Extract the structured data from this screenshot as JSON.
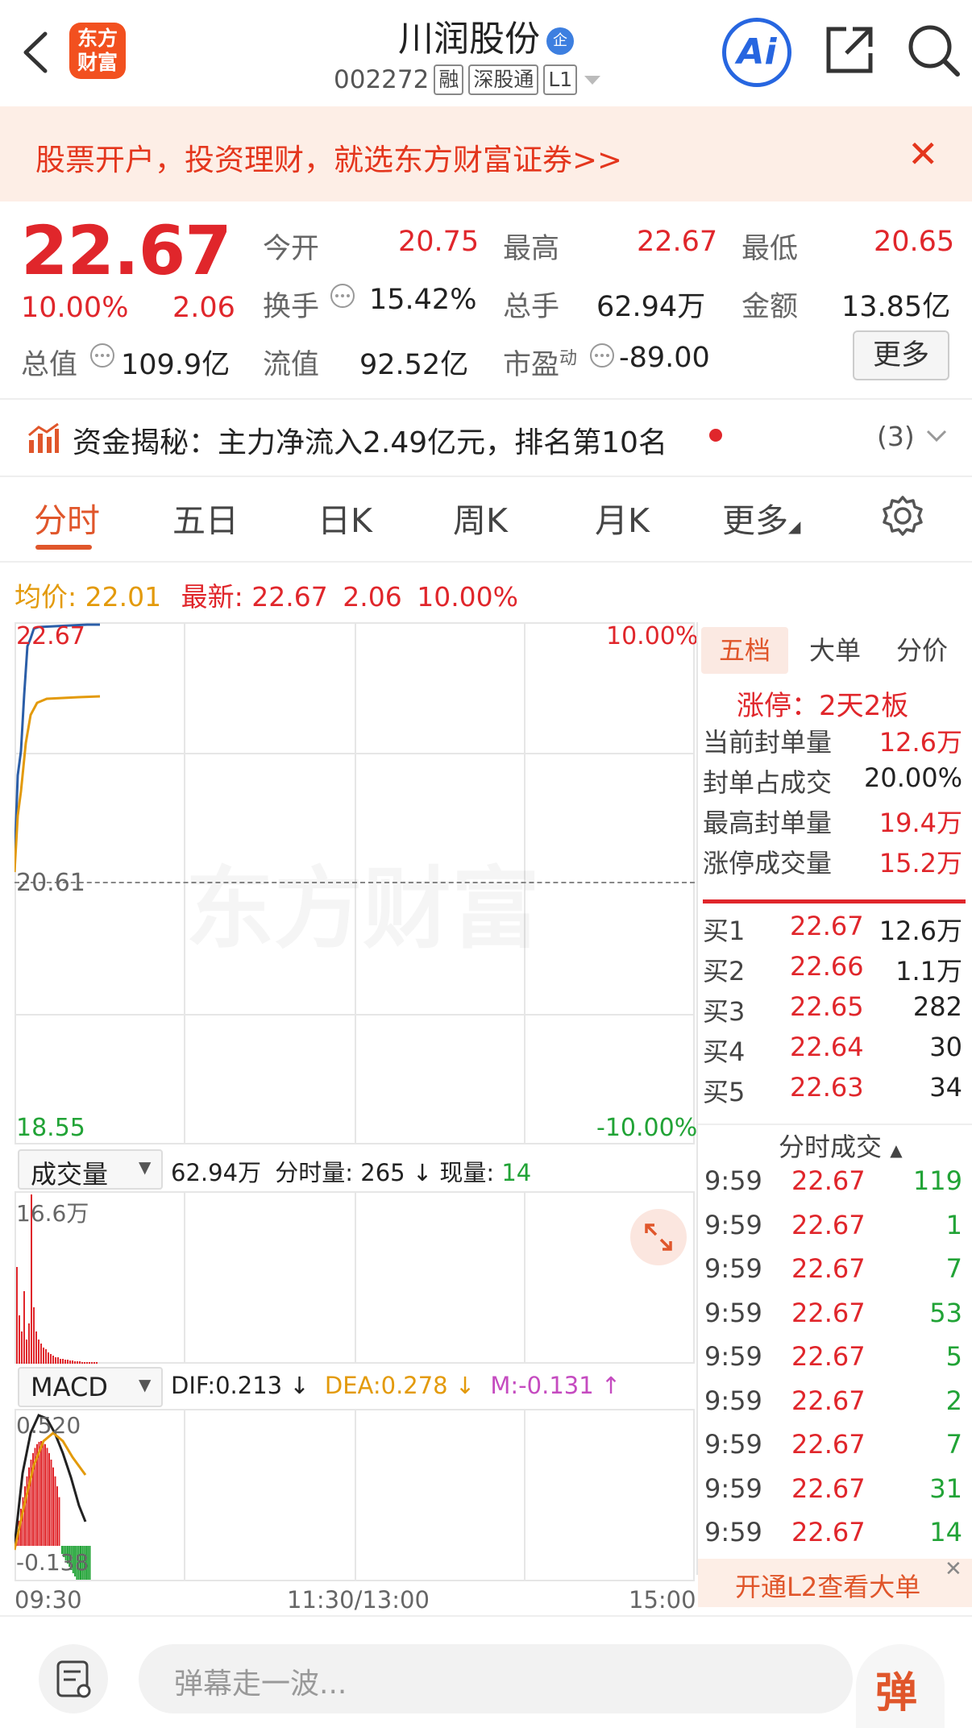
{
  "header": {
    "logo_text": "东方\n财富",
    "title": "川润股份",
    "title_badge": "企",
    "code": "002272",
    "tags": [
      "融",
      "深股通",
      "L1"
    ],
    "ai_label": "Ai"
  },
  "banner": {
    "text": "股票开户，投资理财，就选东方财富证券>>",
    "close": "✕"
  },
  "quote": {
    "price": "22.67",
    "change_pct": "10.00%",
    "change": "2.06",
    "open_label": "今开",
    "open": "20.75",
    "high_label": "最高",
    "high": "22.67",
    "low_label": "最低",
    "low": "20.65",
    "turnover_label": "换手",
    "turnover": "15.42%",
    "volume_label": "总手",
    "volume": "62.94万",
    "amount_label": "金额",
    "amount": "13.85亿",
    "mktcap_label": "总值",
    "mktcap": "109.9亿",
    "float_label": "流值",
    "float": "92.52亿",
    "pe_label": "市盈",
    "pe_sup": "动",
    "pe": "-89.00",
    "more_button": "更多"
  },
  "fund_flow": {
    "text": "资金揭秘：主力净流入2.49亿元，排名第10名",
    "count": "(3)"
  },
  "tabs": [
    "分时",
    "五日",
    "日K",
    "周K",
    "月K",
    "更多"
  ],
  "intraday": {
    "avg_label": "均价:",
    "avg": "22.01",
    "latest_label": "最新:",
    "latest": "22.67",
    "change": "2.06",
    "change_pct": "10.00%",
    "y_top": "22.67",
    "y_mid": "20.61",
    "y_bot": "18.55",
    "pct_top": "10.00%",
    "pct_bot": "-10.00%",
    "watermark": "东方财富"
  },
  "volume": {
    "selector": "成交量",
    "total": "62.94万",
    "minute_label": "分时量:",
    "minute": "265",
    "current_label": "现量:",
    "current": "14",
    "max": "16.6万"
  },
  "macd": {
    "selector": "MACD",
    "dif": "DIF:0.213",
    "dea": "DEA:0.278",
    "m": "M:-0.131",
    "top": "0.520",
    "bot": "-0.138"
  },
  "time_axis": {
    "start": "09:30",
    "mid": "11:30/13:00",
    "end": "15:00"
  },
  "panel": {
    "tabs": [
      "五档",
      "大单",
      "分价"
    ],
    "limit": "涨停：2天2板",
    "stats": [
      {
        "label": "当前封单量",
        "value": "12.6万"
      },
      {
        "label": "封单占成交",
        "value": "20.00%"
      },
      {
        "label": "最高封单量",
        "value": "19.4万"
      },
      {
        "label": "涨停成交量",
        "value": "15.2万"
      }
    ],
    "bids": [
      {
        "label": "买1",
        "price": "22.67",
        "vol": "12.6万"
      },
      {
        "label": "买2",
        "price": "22.66",
        "vol": "1.1万"
      },
      {
        "label": "买3",
        "price": "22.65",
        "vol": "282"
      },
      {
        "label": "买4",
        "price": "22.64",
        "vol": "30"
      },
      {
        "label": "买5",
        "price": "22.63",
        "vol": "34"
      }
    ],
    "ticks_title": "分时成交",
    "ticks": [
      {
        "time": "9:59",
        "price": "22.67",
        "vol": "119"
      },
      {
        "time": "9:59",
        "price": "22.67",
        "vol": "1"
      },
      {
        "time": "9:59",
        "price": "22.67",
        "vol": "7"
      },
      {
        "time": "9:59",
        "price": "22.67",
        "vol": "53"
      },
      {
        "time": "9:59",
        "price": "22.67",
        "vol": "5"
      },
      {
        "time": "9:59",
        "price": "22.67",
        "vol": "2"
      },
      {
        "time": "9:59",
        "price": "22.67",
        "vol": "7"
      },
      {
        "time": "9:59",
        "price": "22.67",
        "vol": "31"
      },
      {
        "time": "9:59",
        "price": "22.67",
        "vol": "14"
      }
    ],
    "l2_banner": "开通L2查看大单"
  },
  "bottom": {
    "placeholder": "弹幕走一波...",
    "danmu": "弹"
  },
  "colors": {
    "up": "#e0262b",
    "down": "#21a336",
    "accent": "#e0562b",
    "avg_line": "#e39a0b",
    "price_line": "#2b5ea8"
  }
}
